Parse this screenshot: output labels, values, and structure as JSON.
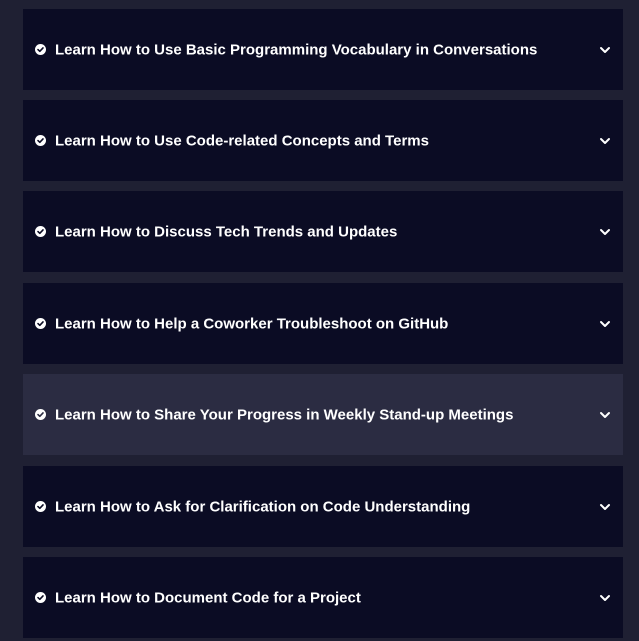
{
  "accordion": {
    "items": [
      {
        "title": "Learn How to Use Basic Programming Vocabulary in Conversations"
      },
      {
        "title": "Learn How to Use Code-related Concepts and Terms"
      },
      {
        "title": "Learn How to Discuss Tech Trends and Updates"
      },
      {
        "title": "Learn How to Help a Coworker Troubleshoot on GitHub"
      },
      {
        "title": "Learn How to Share Your Progress in Weekly Stand-up Meetings"
      },
      {
        "title": "Learn How to Ask for Clarification on Code Understanding"
      },
      {
        "title": "Learn How to Document Code for a Project"
      }
    ],
    "icons": {
      "status": "check-circle-icon",
      "toggle": "chevron-down-icon"
    },
    "colors": {
      "page_background": "#1f2033",
      "item_background": "#0b0c24",
      "item_hover_background": "#2b2c42",
      "text": "#ffffff"
    }
  }
}
